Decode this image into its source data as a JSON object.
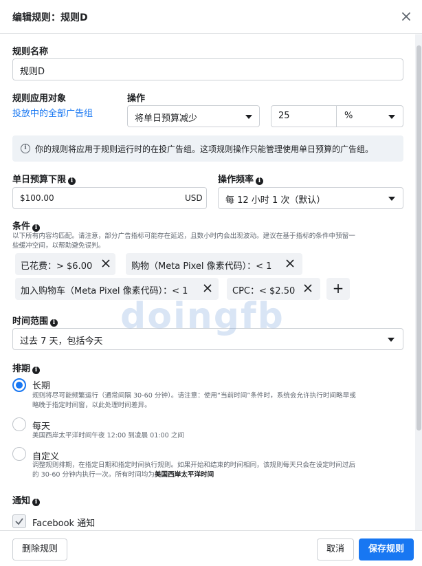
{
  "dialog": {
    "title": "编辑规则：规则D"
  },
  "rule_name": {
    "label": "规则名称",
    "value": "规则D"
  },
  "applies_to": {
    "label": "规则应用对象",
    "link": "投放中的全部广告组"
  },
  "action": {
    "label": "操作",
    "selected": "将单日预算减少",
    "amount": "25",
    "unit": "%"
  },
  "notice": "你的规则将应用于规则运行时的在投广告组。这项规则操作只能管理使用单日预算的广告组。",
  "min_budget": {
    "label": "单日预算下限",
    "value": "$100.00",
    "currency": "USD"
  },
  "frequency": {
    "label": "操作频率",
    "selected": "每 12 小时 1 次（默认）"
  },
  "conditions": {
    "label": "条件",
    "desc_line1": "以下所有内容均匹配。请注意，部分广告指标可能存在延迟，且数小时内会出现波动。建议在基于指标的条件中预留一",
    "desc_line2": "些缓冲空间，以帮助避免误判。",
    "chips": [
      {
        "text": "已花费：> $6.00"
      },
      {
        "text": "购物（Meta Pixel 像素代码）：< 1"
      },
      {
        "text": "加入购物车（Meta Pixel 像素代码）：< 1"
      },
      {
        "text": "CPC：< $2.50"
      }
    ],
    "add": "+"
  },
  "time_range": {
    "label": "时间范围",
    "selected": "过去 7 天，包括今天"
  },
  "schedule": {
    "label": "排期",
    "options": [
      {
        "title": "长期",
        "desc_line1": "规则将尽可能频繁运行（通常间隔 30-60 分钟）。请注意：使用“当前时间”条件时，系统会允许执行时间略早或",
        "desc_line2": "略晚于指定时间窗，以此处理时间差异。",
        "selected": true
      },
      {
        "title": "每天",
        "desc_line1": "美国西岸太平洋时间午夜 12:00 到凌晨 01:00 之间",
        "selected": false
      },
      {
        "title": "自定义",
        "desc_line1": "调整规则排期，在指定日期和指定时间执行规则。如果开始和结束的时间相同，该规则每天只会在设定时间过后",
        "desc_line2_a": "的 30-60 分钟内执行一次。所有时间均为",
        "desc_line2_b": "美国西岸太平洋时间",
        "selected": false
      }
    ]
  },
  "notify": {
    "label": "通知",
    "facebook": "Facebook 通知"
  },
  "watermark": "doingfb",
  "footer": {
    "delete": "删除规则",
    "cancel": "取消",
    "save": "保存规则"
  },
  "colors": {
    "accent": "#1877f2",
    "notice_bg": "#eef2f6",
    "chip_bg": "#f0f2f5"
  }
}
